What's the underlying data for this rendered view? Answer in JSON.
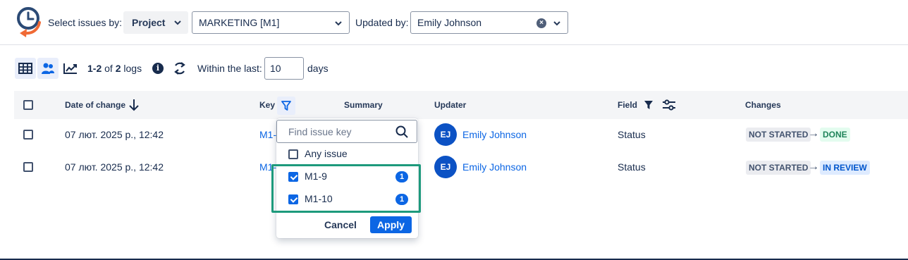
{
  "filters": {
    "select_issues_label": "Select issues by:",
    "select_issues_value": "Project",
    "project_value": "MARKETING [M1]",
    "updated_by_label": "Updated by:",
    "updated_by_value": "Emily Johnson"
  },
  "toolbar": {
    "range_text": "1-2",
    "of_text": "of",
    "total_text": "2",
    "logs_text": "logs",
    "info_icon_glyph": "i",
    "within_label": "Within the last:",
    "days_value": "10",
    "days_label": "days"
  },
  "table": {
    "headers": {
      "date": "Date of change",
      "key": "Key",
      "summary": "Summary",
      "updater": "Updater",
      "field": "Field",
      "changes": "Changes"
    },
    "rows": [
      {
        "date": "07 лют. 2025 р., 12:42",
        "key": "M1-",
        "updater_initials": "EJ",
        "updater": "Emily Johnson",
        "field": "Status",
        "from": "NOT STARTED",
        "to": "DONE"
      },
      {
        "date": "07 лют. 2025 р., 12:42",
        "key": "M1-",
        "updater_initials": "EJ",
        "updater": "Emily Johnson",
        "field": "Status",
        "from": "NOT STARTED",
        "to": "IN REVIEW"
      }
    ]
  },
  "key_filter": {
    "search_placeholder": "Find issue key",
    "items": [
      {
        "label": "Any issue",
        "checked": false,
        "count": ""
      },
      {
        "label": "M1-9",
        "checked": true,
        "count": "1"
      },
      {
        "label": "M1-10",
        "checked": true,
        "count": "1"
      }
    ],
    "cancel_label": "Cancel",
    "apply_label": "Apply"
  },
  "colors": {
    "accent": "#0c66e4",
    "highlight": "#1d9a7c",
    "done": "#1f845a",
    "in_review": "#0055cc"
  }
}
